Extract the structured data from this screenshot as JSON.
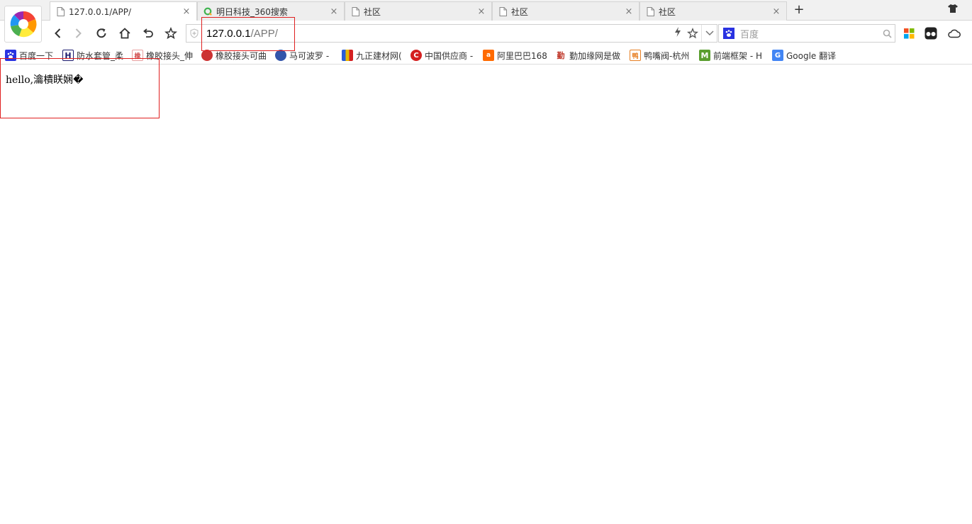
{
  "browser": {
    "tabs": [
      {
        "title": "127.0.0.1/APP/",
        "icon": "document-icon",
        "active": true
      },
      {
        "title": "明日科技_360搜索",
        "icon": "360-search-icon",
        "active": false
      },
      {
        "title": "社区",
        "icon": "document-icon",
        "active": false
      },
      {
        "title": "社区",
        "icon": "document-icon",
        "active": false
      },
      {
        "title": "社区",
        "icon": "document-icon",
        "active": false
      }
    ],
    "tab_close_glyph": "×",
    "new_tab_glyph": "+",
    "address": {
      "host": "127.0.0.1",
      "path": "/APP/"
    },
    "search": {
      "engine_icon": "baidu-paw-icon",
      "placeholder": "百度"
    },
    "bookmarks": [
      {
        "label": "百度一下",
        "icon": "baidu-paw-icon",
        "color": "#2932e1"
      },
      {
        "label": "防水套管_柔",
        "icon": "h-logo-icon",
        "color": "#1a1a6e"
      },
      {
        "label": "橡胶接头_伸",
        "icon": "site-favicon-icon",
        "color": "#e8a0a0"
      },
      {
        "label": "橡胶接头可曲",
        "icon": "site-favicon-icon",
        "color": "#cc3333"
      },
      {
        "label": "马可波罗 -",
        "icon": "marco-polo-icon",
        "color": "#3355aa"
      },
      {
        "label": "九正建材网(",
        "icon": "jiuzheng-icon",
        "color": "#e6b800"
      },
      {
        "label": "中国供应商 -",
        "icon": "china-supplier-icon",
        "color": "#d42020"
      },
      {
        "label": "阿里巴巴168",
        "icon": "alibaba-icon",
        "color": "#ff6a00"
      },
      {
        "label": "勤加缘网是做",
        "icon": "qinjiayuan-icon",
        "color": "#c0392b"
      },
      {
        "label": "鸭嘴阀-杭州",
        "icon": "duckbill-icon",
        "color": "#e67e22"
      },
      {
        "label": "前端框架 - H",
        "icon": "m-logo-icon",
        "color": "#5a9e2f"
      },
      {
        "label": "Google 翻译",
        "icon": "google-translate-icon",
        "color": "#4285f4"
      }
    ]
  },
  "page": {
    "content_text": "hello,瀹樻眹娴�"
  }
}
